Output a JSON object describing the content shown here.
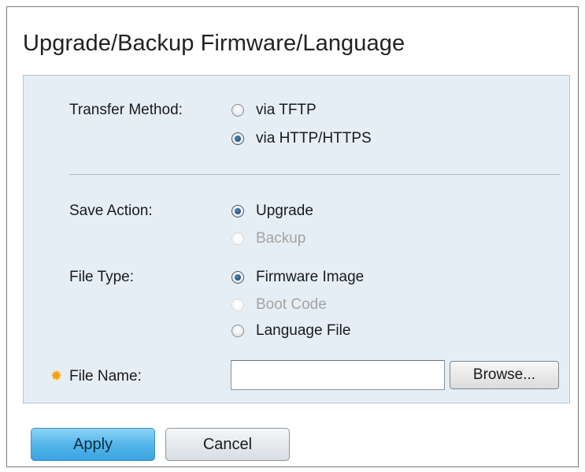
{
  "page": {
    "title": "Upgrade/Backup Firmware/Language"
  },
  "form": {
    "transfer_method": {
      "label": "Transfer Method:",
      "options": [
        {
          "label": "via TFTP",
          "checked": false,
          "disabled": false
        },
        {
          "label": "via HTTP/HTTPS",
          "checked": true,
          "disabled": false
        }
      ]
    },
    "save_action": {
      "label": "Save Action:",
      "options": [
        {
          "label": "Upgrade",
          "checked": true,
          "disabled": false
        },
        {
          "label": "Backup",
          "checked": false,
          "disabled": true
        }
      ]
    },
    "file_type": {
      "label": "File Type:",
      "options": [
        {
          "label": "Firmware Image",
          "checked": true,
          "disabled": false
        },
        {
          "label": "Boot Code",
          "checked": false,
          "disabled": true
        },
        {
          "label": "Language File",
          "checked": false,
          "disabled": false
        }
      ]
    },
    "file_name": {
      "label": "File Name:",
      "value": "",
      "browse_label": "Browse..."
    }
  },
  "actions": {
    "apply_label": "Apply",
    "cancel_label": "Cancel"
  },
  "icons": {
    "required": "required-asterisk-icon"
  },
  "colors": {
    "panel_bg": "#e6eef5",
    "apply_btn": "#55b6ea",
    "required_icon": "#f3a30b"
  }
}
